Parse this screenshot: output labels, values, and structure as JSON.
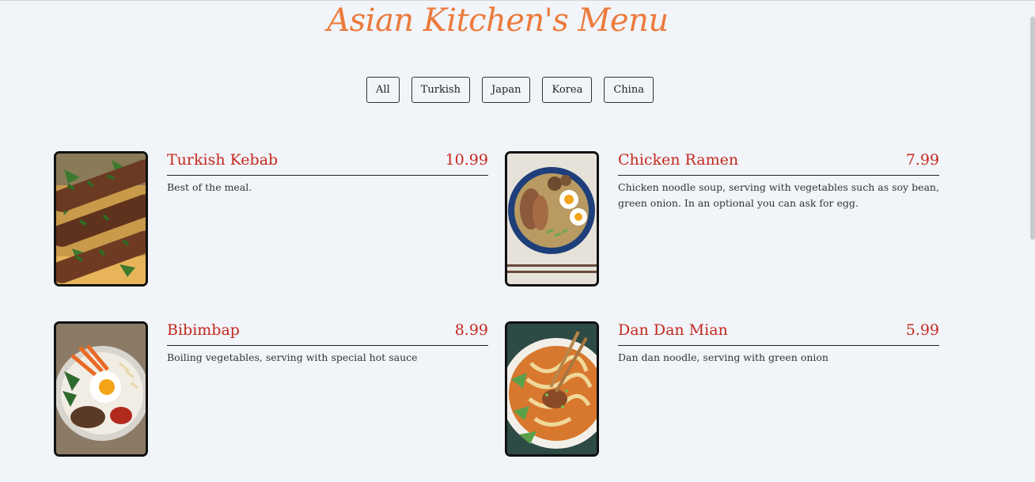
{
  "title": "Asian Kitchen's Menu",
  "filters": [
    "All",
    "Turkish",
    "Japan",
    "Korea",
    "China"
  ],
  "menu": [
    {
      "name": "Turkish Kebab",
      "price": "10.99",
      "desc": "Best of the meal.",
      "photo_icon": "kebab-photo"
    },
    {
      "name": "Chicken Ramen",
      "price": "7.99",
      "desc": "Chicken noodle soup, serving with vegetables such as soy bean, green onion. In an optional you can ask for egg.",
      "photo_icon": "ramen-photo"
    },
    {
      "name": "Bibimbap",
      "price": "8.99",
      "desc": "Boiling vegetables, serving with special hot sauce",
      "photo_icon": "bibimbap-photo"
    },
    {
      "name": "Dan Dan Mian",
      "price": "5.99",
      "desc": "Dan dan noodle, serving with green onion",
      "photo_icon": "noodle-photo"
    }
  ],
  "colors": {
    "accent": "#ec7a3c",
    "item_title": "#c4281e",
    "background": "#f1f4f8"
  }
}
